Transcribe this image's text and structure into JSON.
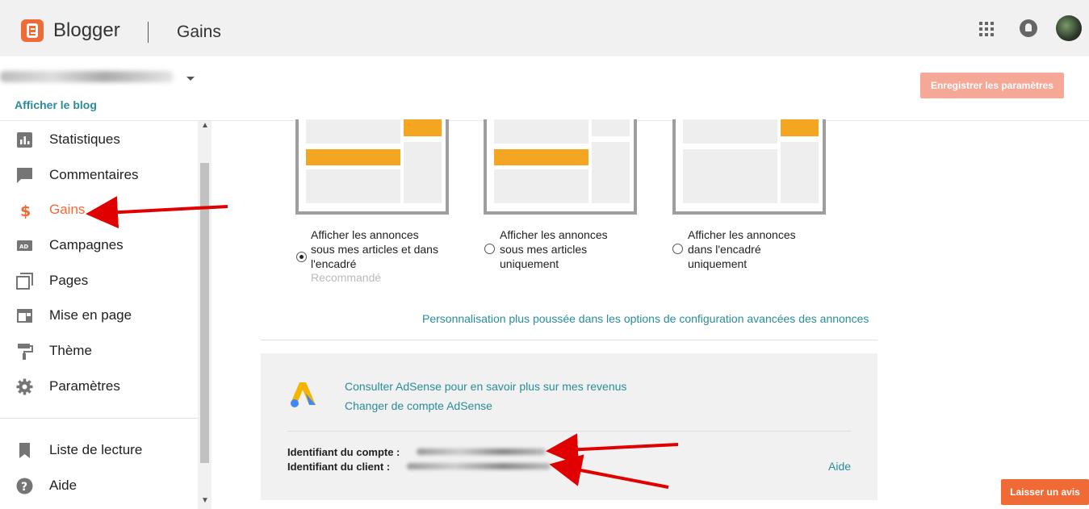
{
  "header": {
    "brand": "Blogger",
    "page_title": "Gains",
    "icons": [
      "apps-icon",
      "notifications-icon",
      "avatar"
    ]
  },
  "subbar": {
    "view_blog": "Afficher le blog",
    "save_button": "Enregistrer les paramètres"
  },
  "sidebar": {
    "items": [
      {
        "label": "Statistiques",
        "icon": "stats-icon"
      },
      {
        "label": "Commentaires",
        "icon": "comment-icon"
      },
      {
        "label": "Gains",
        "icon": "dollar-icon",
        "active": true
      },
      {
        "label": "Campagnes",
        "icon": "ad-icon"
      },
      {
        "label": "Pages",
        "icon": "pages-icon"
      },
      {
        "label": "Mise en page",
        "icon": "layout-icon"
      },
      {
        "label": "Thème",
        "icon": "paint-roller-icon"
      },
      {
        "label": "Paramètres",
        "icon": "gear-icon"
      },
      {
        "label": "Liste de lecture",
        "icon": "bookmark-icon"
      },
      {
        "label": "Aide",
        "icon": "help-icon"
      }
    ]
  },
  "ads_placement": {
    "options": [
      {
        "lines": [
          "Afficher les annonces",
          "sous mes articles et dans",
          "l'encadré"
        ],
        "selected": true
      },
      {
        "lines": [
          "Afficher les annonces",
          "sous mes articles",
          "uniquement"
        ],
        "selected": false
      },
      {
        "lines": [
          "Afficher les annonces",
          "dans l'encadré",
          "uniquement"
        ],
        "selected": false
      }
    ],
    "recommended": "Recommandé",
    "advanced_link": "Personnalisation plus poussée dans les options de configuration avancées des annonces"
  },
  "adsense": {
    "consult_link": "Consulter AdSense pour en savoir plus sur mes revenus",
    "change_link": "Changer de compte AdSense",
    "account_id_label": "Identifiant du compte :",
    "client_id_label": "Identifiant du client :",
    "help_link": "Aide"
  },
  "feedback_button": "Laisser un avis",
  "colors": {
    "accent": "#f06a35",
    "link": "#2a8c9a",
    "ad_placeholder": "#f4a623",
    "arrow": "#e00000"
  }
}
